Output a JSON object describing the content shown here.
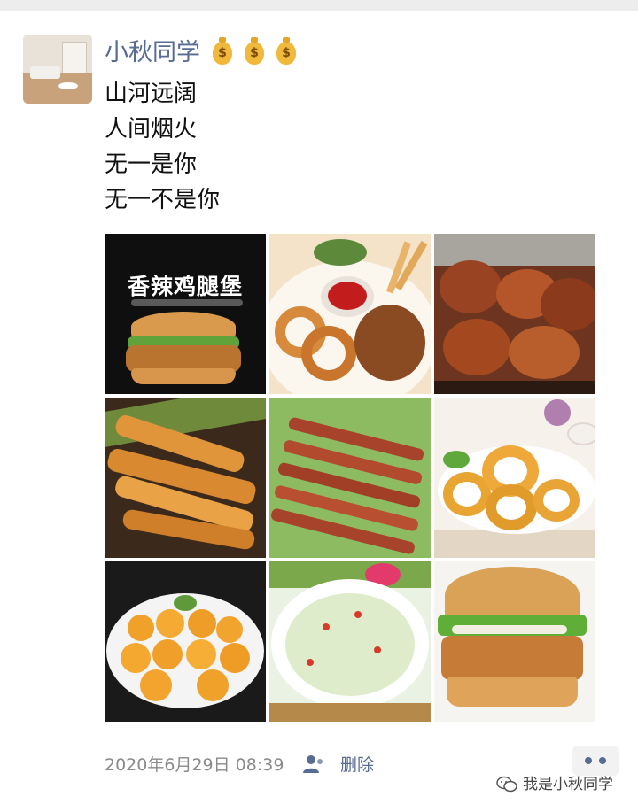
{
  "post": {
    "username": "小秋同学",
    "username_emoji": [
      "💰",
      "💰",
      "💰"
    ],
    "text_lines": [
      "山河远阔",
      "人间烟火",
      "无一是你",
      "无一不是你"
    ],
    "photo_subjects": [
      "spicy-chicken-burger-poster",
      "fried-chicken-onion-rings-ketchup",
      "fried-chicken-wings",
      "fried-chicken-strips",
      "grilled-skewers",
      "onion-rings",
      "fried-cheese-balls",
      "vegetable-fried-rice",
      "chicken-burger"
    ],
    "poster_title": "香辣鸡腿堡",
    "timestamp": "2020年6月29日 08:39",
    "delete_label": "删除",
    "watermark": "我是小秋同学"
  },
  "colors": {
    "name_link": "#576b95",
    "body_text": "#111111",
    "meta_text": "#8a8a8a",
    "more_button_bg": "#f2f2f2"
  },
  "icons": [
    "money-bag-icon",
    "friend-visibility-icon",
    "more-dots-icon",
    "wechat-icon"
  ]
}
